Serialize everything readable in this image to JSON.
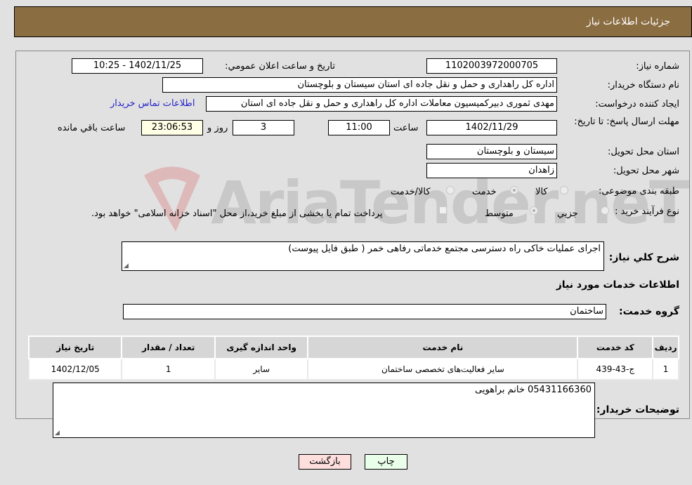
{
  "header": {
    "title": "جزئیات اطلاعات نیاز"
  },
  "watermark": {
    "text": "AriaTender.neT"
  },
  "form": {
    "need_number": {
      "label": "شماره نیاز:",
      "value": "1102003972000705"
    },
    "announce_datetime": {
      "label": "تاریخ و ساعت اعلان عمومي:",
      "value": "1402/11/25 - 10:25"
    },
    "buyer_org": {
      "label": "نام دستگاه خريدار:",
      "value": "اداره کل راهداری و حمل و نقل جاده ای استان سیستان و بلوچستان"
    },
    "requester": {
      "label": "ايجاد کننده درخواست:",
      "value": "مهدی ثموری دبیرکمیسیون معاملات اداره کل راهداری و حمل و نقل جاده ای استان",
      "contact_link": "اطلاعات تماس خريدار"
    },
    "deadline": {
      "label": "مهلت ارسال پاسخ: تا تاریخ:",
      "date": "1402/11/29",
      "time_label": "ساعت",
      "time": "11:00",
      "days": "3",
      "days_label": "روز و",
      "remaining": "23:06:53",
      "remaining_label": "ساعت باقي مانده"
    },
    "province": {
      "label": "استان محل تحويل:",
      "value": "سیستان و بلوچستان"
    },
    "city": {
      "label": "شهر محل تحويل:",
      "value": "زاهدان"
    },
    "category": {
      "label": "طبقه بندی موضوعی:",
      "options": [
        "کالا",
        "خدمت",
        "کالا/خدمت"
      ],
      "selected": "خدمت"
    },
    "purchase_type": {
      "label": "نوع فرآيند خريد :",
      "options": [
        "جزيي",
        "متوسط"
      ],
      "selected": "متوسط",
      "treasury_note": "پرداخت تمام يا بخشی از مبلغ خريد،از محل \"اسناد خزانه اسلامی\" خواهد بود."
    },
    "description": {
      "label": "شرح کلي نياز:",
      "value": "اجرای عملیات خاکی راه دسترسی مجتمع خدماتی رفاهی خمر ( طبق فایل پیوست)"
    },
    "services_heading": "اطلاعات خدمات مورد نياز",
    "service_group": {
      "label": "گروه خدمت:",
      "value": "ساختمان"
    }
  },
  "table": {
    "headers": [
      "رديف",
      "کد خدمت",
      "نام خدمت",
      "واحد اندازه گيری",
      "تعداد / مقدار",
      "تاريخ نياز"
    ],
    "rows": [
      [
        "1",
        "ج-43-439",
        "سایر فعالیت‌های تخصصی ساختمان",
        "سایر",
        "1",
        "1402/12/05"
      ]
    ]
  },
  "buyer_notes": {
    "label": "توضيحات خريدار:",
    "value": "05431166360 خانم براهویی"
  },
  "buttons": {
    "print": "چاپ",
    "back": "بازگشت"
  },
  "colors": {
    "header_bg": "#8b6d42",
    "print_bg": "#eaffea",
    "back_bg": "#ffdede",
    "link": "#2222cc"
  }
}
